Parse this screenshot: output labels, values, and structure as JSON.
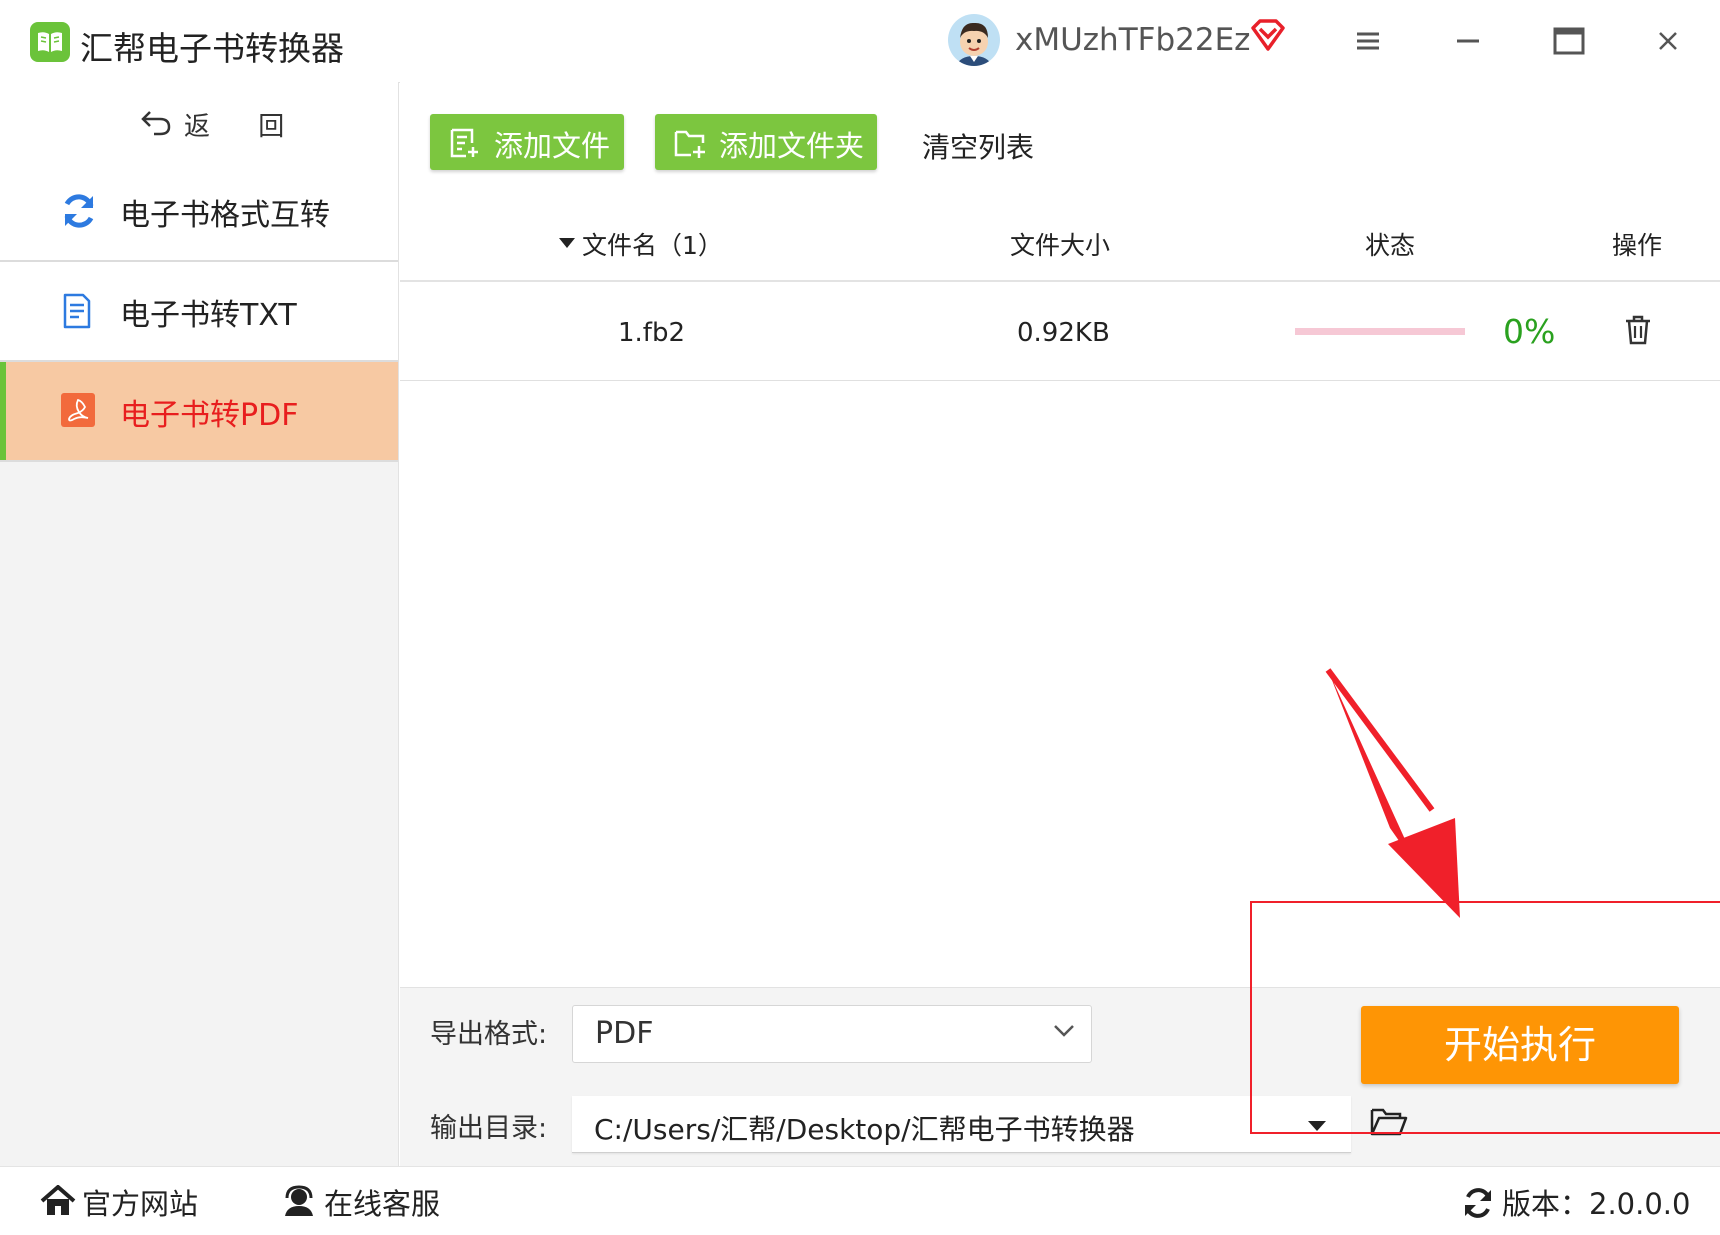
{
  "app": {
    "title": "汇帮电子书转换器",
    "username": "xMUzhTFb22Ez"
  },
  "sidebar": {
    "back_label": "返 回",
    "items": [
      {
        "label": "电子书格式互转",
        "icon": "refresh-icon"
      },
      {
        "label": "电子书转TXT",
        "icon": "document-icon"
      },
      {
        "label": "电子书转PDF",
        "icon": "pdf-icon",
        "active": true
      }
    ]
  },
  "toolbar": {
    "add_file": "添加文件",
    "add_folder": "添加文件夹",
    "clear_list": "清空列表"
  },
  "table": {
    "headers": {
      "name": "文件名（1）",
      "size": "文件大小",
      "status": "状态",
      "action": "操作"
    },
    "rows": [
      {
        "name": "1.fb2",
        "size": "0.92KB",
        "progress": 0,
        "progress_label": "0%"
      }
    ]
  },
  "settings": {
    "format_label": "导出格式:",
    "format_value": "PDF",
    "dir_label": "输出目录:",
    "dir_value": "C:/Users/汇帮/Desktop/汇帮电子书转换器",
    "start_button": "开始执行"
  },
  "footer": {
    "website": "官方网站",
    "support": "在线客服",
    "version": "版本：2.0.0.0"
  },
  "colors": {
    "brand_green": "#7cc63f",
    "start_orange": "#fe9505",
    "active_bg": "#f7c9a3",
    "active_text": "#e81e1e",
    "progress_pink": "#f6c8d5",
    "percent_green": "#2aa11f",
    "annotation_red": "#f0202a"
  }
}
